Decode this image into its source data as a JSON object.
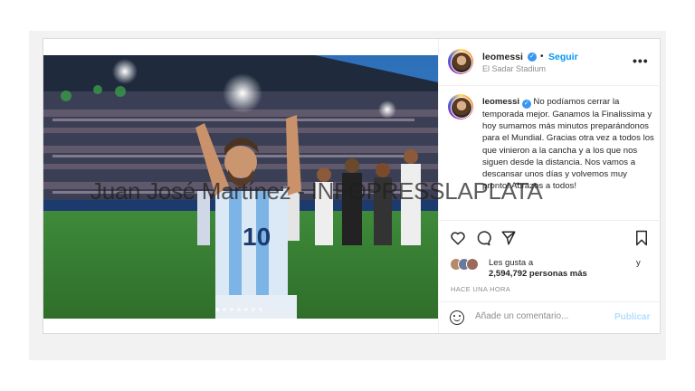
{
  "post": {
    "username": "leomessi",
    "follow_label": "Seguir",
    "location": "El Sadar Stadium",
    "more_label": "•••",
    "caption_user": "leomessi",
    "caption_text": "No podíamos cerrar la temporada mejor. Ganamos la Finalissima y hoy sumamos más minutos preparándonos para el Mundial. Gracias otra vez a todos los que vinieron a la cancha y a los que nos siguen desde la distancia. Nos vamos a descansar unos días y volvemos muy pronto! Abrazos a todos!",
    "likes_prefix": "Les gusta a",
    "likes_suffix": "y",
    "likes_count": "2,594,792 personas más",
    "time_ago": "HACE UNA HORA",
    "comment_placeholder": "Añade un comentario...",
    "publish_label": "Publicar",
    "carousel": {
      "count": 7,
      "active": 0
    }
  },
  "icons": [
    "verified-icon",
    "more-icon",
    "heart-icon",
    "comment-icon",
    "share-icon",
    "bookmark-icon",
    "emoji-icon"
  ],
  "watermark": "Juan José Martínez - INFOPRESSLAPLATA",
  "colors": {
    "link": "#0095f6",
    "verified": "#3897f0",
    "publish_disabled": "#b2dffc",
    "muted": "#8e8e8e"
  }
}
